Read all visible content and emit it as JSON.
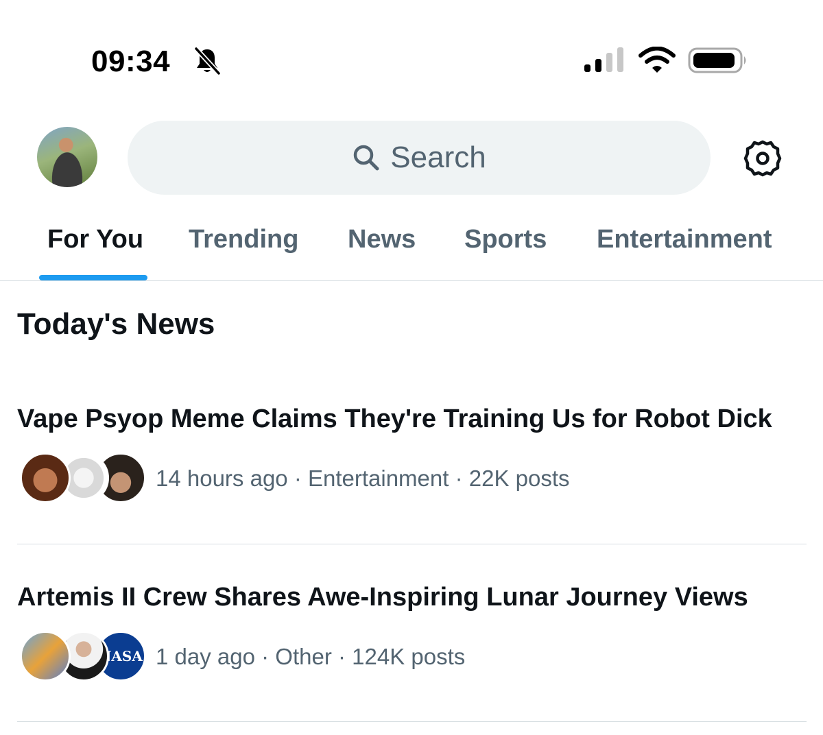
{
  "status_bar": {
    "time": "09:34",
    "icons": [
      "bell-off-icon",
      "signal-icon",
      "wifi-icon",
      "battery-icon"
    ]
  },
  "header": {
    "search_placeholder": "Search"
  },
  "tabs": [
    {
      "label": "For You",
      "active": true
    },
    {
      "label": "Trending",
      "active": false
    },
    {
      "label": "News",
      "active": false
    },
    {
      "label": "Sports",
      "active": false
    },
    {
      "label": "Entertainment",
      "active": false
    }
  ],
  "colors": {
    "accent": "#1d9bf0",
    "text_primary": "#0f1419",
    "text_secondary": "#536471",
    "search_bg": "#eff3f4",
    "nasa_blue": "#0b3d91"
  },
  "section": {
    "title": "Today's News",
    "items": [
      {
        "headline": "Vape Psyop Meme Claims They're Training Us for Robot Dick",
        "meta": "14 hours ago · Entertainment · 22K posts"
      },
      {
        "headline": "Artemis II Crew Shares Awe-Inspiring Lunar Journey Views",
        "meta": "1 day ago · Other · 124K posts",
        "logo_text": "NASA"
      }
    ]
  }
}
